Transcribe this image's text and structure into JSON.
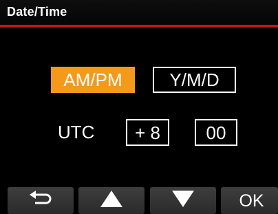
{
  "header": {
    "title": "Date/Time"
  },
  "settings": {
    "time_format": "AM/PM",
    "date_format": "Y/M/D",
    "utc_label": "UTC",
    "utc_offset_hours": "+ 8",
    "utc_offset_minutes": "00",
    "selected": "time_format"
  },
  "footer": {
    "back_icon": "back-arrow-icon",
    "up_icon": "triangle-up-icon",
    "down_icon": "triangle-down-icon",
    "ok_label": "OK"
  },
  "colors": {
    "accent": "#f39a1b",
    "header_rule": "#c8141b",
    "background": "#000000",
    "button": "#333333"
  }
}
